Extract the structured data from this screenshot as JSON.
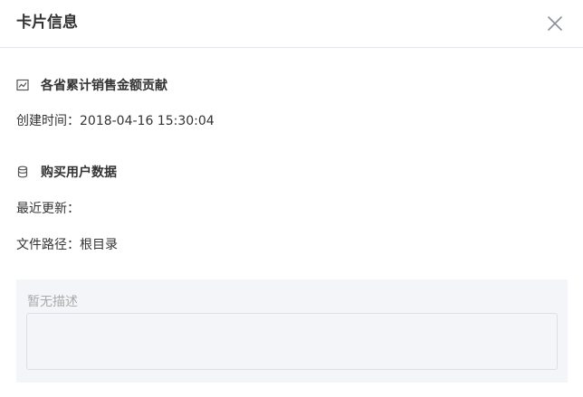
{
  "dialog": {
    "title": "卡片信息",
    "close_icon": "close-icon"
  },
  "chart_section": {
    "icon": "line-chart-icon",
    "title": "各省累计销售金额贡献",
    "created_label": "创建时间：",
    "created_value": "2018-04-16 15:30:04"
  },
  "dataset_section": {
    "icon": "database-icon",
    "title": "购买用户数据",
    "updated_label": "最近更新：",
    "updated_value": "",
    "path_label": "文件路径：",
    "path_value": "根目录"
  },
  "description": {
    "placeholder": "暂无描述",
    "value": ""
  }
}
